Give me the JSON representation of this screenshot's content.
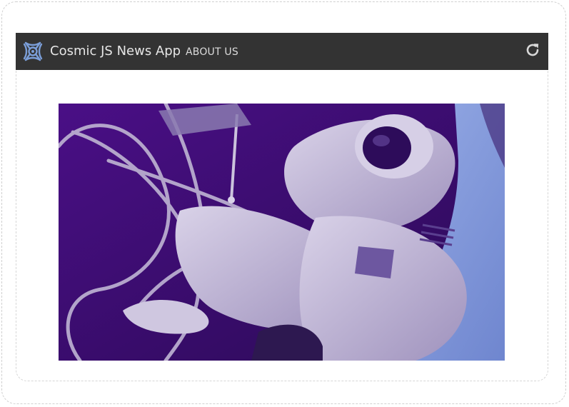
{
  "app": {
    "title": "Cosmic JS News App"
  },
  "nav": {
    "about_label": "ABOUT US"
  },
  "icons": {
    "logo": "cosmic-logo-icon",
    "refresh": "refresh-icon"
  },
  "colors": {
    "navbar_bg": "#333333",
    "brand_text": "#e6e6e6",
    "logo_blue": "#7b9ed8",
    "hero_purple": "#3b0f73",
    "hero_earth": "#7f96d6"
  }
}
